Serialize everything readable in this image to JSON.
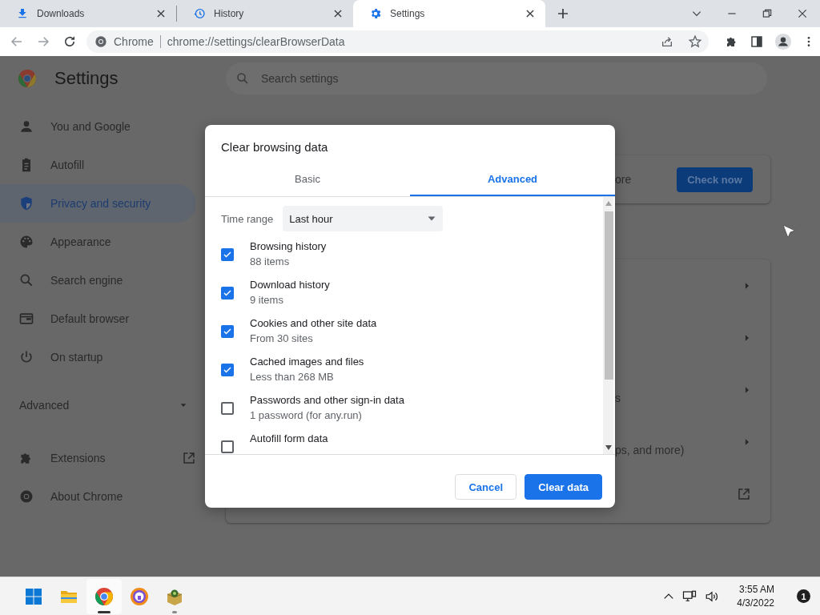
{
  "tabs": [
    {
      "label": "Downloads",
      "kind": "download",
      "selected": false
    },
    {
      "label": "History",
      "kind": "history",
      "selected": false
    },
    {
      "label": "Settings",
      "kind": "settings",
      "selected": true
    }
  ],
  "address_bar": {
    "origin": "Chrome",
    "url": "chrome://settings/clearBrowserData"
  },
  "settings": {
    "title": "Settings",
    "search_placeholder": "Search settings",
    "sidebar": [
      {
        "label": "You and Google",
        "kind": "person",
        "selected": false
      },
      {
        "label": "Autofill",
        "kind": "clipboard",
        "selected": false
      },
      {
        "label": "Privacy and security",
        "kind": "shield",
        "selected": true
      },
      {
        "label": "Appearance",
        "kind": "palette",
        "selected": false
      },
      {
        "label": "Search engine",
        "kind": "search",
        "selected": false
      },
      {
        "label": "Default browser",
        "kind": "browser",
        "selected": false
      },
      {
        "label": "On startup",
        "kind": "power",
        "selected": false
      }
    ],
    "advanced": "Advanced",
    "links": [
      {
        "label": "Extensions",
        "kind": "puzzle",
        "external": true
      },
      {
        "label": "About Chrome",
        "kind": "chrome",
        "external": false
      }
    ],
    "safety_check": {
      "text_fragment": "ore",
      "button": "Check now"
    },
    "privacy_rows": [
      {
        "text_fragment": "",
        "kind": "arrow"
      },
      {
        "text_fragment": "",
        "kind": "arrow"
      },
      {
        "text_fragment": "s",
        "kind": "arrow"
      },
      {
        "text_fragment": "ps, and more)",
        "kind": "arrow"
      },
      {
        "text_fragment": "",
        "kind": "external"
      }
    ]
  },
  "dialog": {
    "title": "Clear browsing data",
    "tabs": [
      {
        "label": "Basic",
        "selected": false
      },
      {
        "label": "Advanced",
        "selected": true
      }
    ],
    "time_range": {
      "label": "Time range",
      "value": "Last hour"
    },
    "items": [
      {
        "label": "Browsing history",
        "detail": "88 items",
        "checked": true
      },
      {
        "label": "Download history",
        "detail": "9 items",
        "checked": true
      },
      {
        "label": "Cookies and other site data",
        "detail": "From 30 sites",
        "checked": true
      },
      {
        "label": "Cached images and files",
        "detail": "Less than 268 MB",
        "checked": true
      },
      {
        "label": "Passwords and other sign-in data",
        "detail": "1 password (for any.run)",
        "checked": false
      },
      {
        "label": "Autofill form data",
        "checked": false
      }
    ],
    "buttons": [
      {
        "label": "Cancel",
        "kind": "secondary"
      },
      {
        "label": "Clear data",
        "kind": "primary"
      }
    ]
  },
  "taskbar": {
    "apps": [
      {
        "kind": "start",
        "active": false,
        "running": false
      },
      {
        "kind": "folder",
        "active": false,
        "running": false
      },
      {
        "kind": "chrome",
        "active": true,
        "running": true
      },
      {
        "kind": "shield-browser",
        "active": false,
        "running": false
      },
      {
        "kind": "package",
        "active": false,
        "running": true
      }
    ],
    "time": "3:55 AM",
    "date": "4/3/2022",
    "notifications": "1"
  }
}
